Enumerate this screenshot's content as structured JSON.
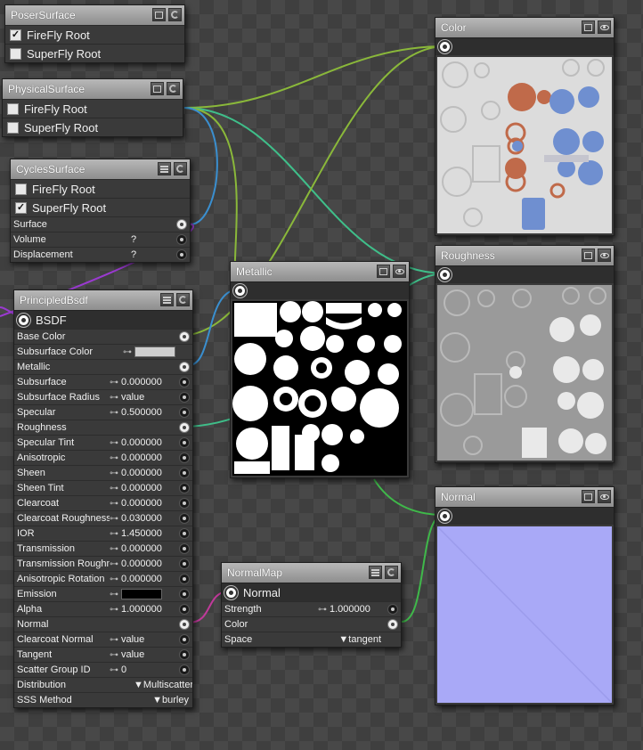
{
  "colors": {
    "wire_green": "#8ab83a",
    "wire_teal": "#3fbf8a",
    "wire_blue": "#3a8fd0",
    "wire_purple": "#9a3ad0",
    "wire_magenta": "#c03a9a",
    "normal_tint": "#a9a9f7"
  },
  "poser_surface": {
    "title": "PoserSurface",
    "rows": [
      {
        "label": "FireFly Root",
        "checked": true,
        "mark": "✓"
      },
      {
        "label": "SuperFly Root",
        "checked": false,
        "mark": ""
      }
    ]
  },
  "physical_surface": {
    "title": "PhysicalSurface",
    "rows": [
      {
        "label": "FireFly Root",
        "mark": ""
      },
      {
        "label": "SuperFly Root",
        "mark": ""
      }
    ]
  },
  "cycles_surface": {
    "title": "CyclesSurface",
    "rows": [
      {
        "label": "FireFly Root",
        "mark": ""
      },
      {
        "label": "SuperFly Root",
        "mark": "✓"
      }
    ],
    "params": [
      {
        "label": "Surface",
        "value": ""
      },
      {
        "label": "Volume",
        "value": "?"
      },
      {
        "label": "Displacement",
        "value": "?"
      }
    ]
  },
  "principled": {
    "title": "PrincipledBsdf",
    "output": "BSDF",
    "params": [
      {
        "label": "Base Color",
        "value": ""
      },
      {
        "label": "Subsurface Color",
        "value": ""
      },
      {
        "label": "Metallic",
        "value": ""
      },
      {
        "label": "Subsurface",
        "value": "0.000000"
      },
      {
        "label": "Subsurface Radius",
        "value": "value"
      },
      {
        "label": "Specular",
        "value": "0.500000"
      },
      {
        "label": "Roughness",
        "value": ""
      },
      {
        "label": "Specular Tint",
        "value": "0.000000"
      },
      {
        "label": "Anisotropic",
        "value": "0.000000"
      },
      {
        "label": "Sheen",
        "value": "0.000000"
      },
      {
        "label": "Sheen Tint",
        "value": "0.000000"
      },
      {
        "label": "Clearcoat",
        "value": "0.000000"
      },
      {
        "label": "Clearcoat Roughness",
        "value": "0.030000"
      },
      {
        "label": "IOR",
        "value": "1.450000"
      },
      {
        "label": "Transmission",
        "value": "0.000000"
      },
      {
        "label": "Transmission Roughness",
        "value": "0.000000"
      },
      {
        "label": "Anisotropic Rotation",
        "value": "0.000000"
      },
      {
        "label": "Emission",
        "value": ""
      },
      {
        "label": "Alpha",
        "value": "1.000000"
      },
      {
        "label": "Normal",
        "value": ""
      },
      {
        "label": "Clearcoat Normal",
        "value": "value"
      },
      {
        "label": "Tangent",
        "value": "value"
      },
      {
        "label": "Scatter Group ID",
        "value": "0"
      },
      {
        "label": "Distribution",
        "value": "Multiscatter"
      },
      {
        "label": "SSS Method",
        "value": "burley"
      }
    ],
    "subsurface_color": "#cfcfcf",
    "emission_color": "#000000"
  },
  "metallic": {
    "title": "Metallic"
  },
  "color_tex": {
    "title": "Color"
  },
  "roughness": {
    "title": "Roughness"
  },
  "normal_tex": {
    "title": "Normal"
  },
  "normal_map": {
    "title": "NormalMap",
    "output": "Normal",
    "params": [
      {
        "label": "Strength",
        "value": "1.000000"
      },
      {
        "label": "Color",
        "value": ""
      },
      {
        "label": "Space",
        "value": "tangent"
      }
    ]
  }
}
